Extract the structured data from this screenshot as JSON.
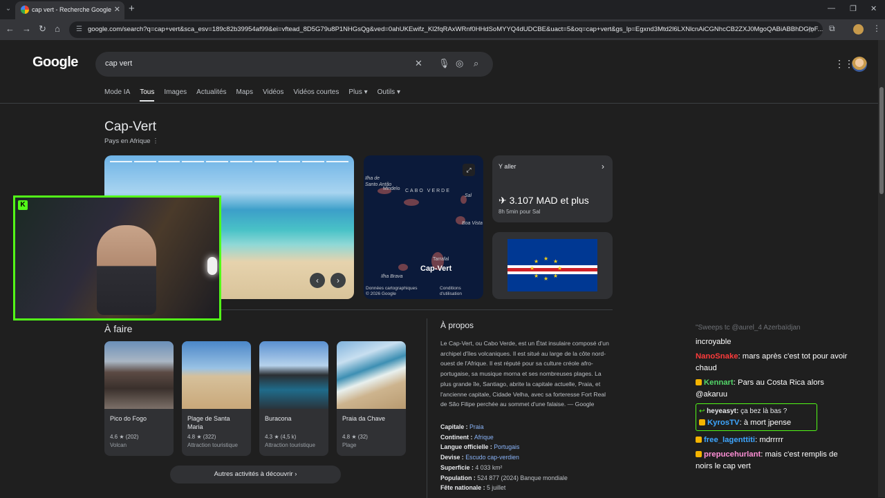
{
  "browser": {
    "tab_title": "cap vert - Recherche Google",
    "new_tab": "+",
    "url": "google.com/search?q=cap+vert&sca_esv=189c82b39954af99&ei=vftead_8D5G79u8P1NHGsQg&ved=0ahUKEwifz_Kl2fqRAxWRnf0HHdSoMYYQ4dUDCBE&uact=5&oq=cap+vert&gs_lp=Egxnd3Mtd2l6LXNlcnAiCGNhcCB2ZXJ0MgoQABiABBhDGIoF..."
  },
  "google": {
    "logo": "Google",
    "query": "cap vert",
    "tabs": [
      "Mode IA",
      "Tous",
      "Images",
      "Actualités",
      "Maps",
      "Vidéos",
      "Vidéos courtes",
      "Plus ▾",
      "Outils ▾"
    ],
    "active_tab": "Tous"
  },
  "knowledge_panel": {
    "title": "Cap-Vert",
    "subtitle": "Pays en Afrique",
    "map": {
      "labels": [
        "Ilha de Santo Antão",
        "Mindelo",
        "CABO VERDE",
        "Sal",
        "Boa Vista",
        "Tarrafal",
        "Cap-Vert",
        "Ilha Brava"
      ],
      "footer_left": "Données cartographiques © 2026 Google",
      "footer_right": "Conditions d'utilisation"
    },
    "travel": {
      "label": "Y aller",
      "price": "✈ 3.107 MAD et plus",
      "duration": "8h 5min pour Sal"
    }
  },
  "a_faire": {
    "title": "À faire",
    "cards": [
      {
        "name": "Pico do Fogo",
        "rating": "4.6 ★ (202)",
        "kind": "Volcan"
      },
      {
        "name": "Plage de Santa Maria",
        "rating": "4.8 ★ (322)",
        "kind": "Attraction touristique"
      },
      {
        "name": "Buracona",
        "rating": "4.3 ★ (4,5 k)",
        "kind": "Attraction touristique"
      },
      {
        "name": "Praia da Chave",
        "rating": "4.8 ★ (32)",
        "kind": "Plage"
      }
    ],
    "more": "Autres activités à découvrir  ›"
  },
  "about": {
    "title": "À propos",
    "text": "Le Cap-Vert, ou Cabo Verde, est un État insulaire composé d'un archipel d'îles volcaniques. Il est situé au large de la côte nord-ouest de l'Afrique. Il est réputé pour sa culture créole afro-portugaise, sa musique morna et ses nombreuses plages. La plus grande île, Santiago, abrite la capitale actuelle, Praia, et l'ancienne capitale, Cidade Velha, avec sa forteresse Fort Real de São Filipe perchée au sommet d'une falaise. — Google",
    "facts": [
      {
        "k": "Capitale : ",
        "v": "Praia",
        "link": true
      },
      {
        "k": "Continent : ",
        "v": "Afrique",
        "link": true
      },
      {
        "k": "Langue officielle : ",
        "v": "Portugais",
        "link": true
      },
      {
        "k": "Devise : ",
        "v": "Escudo cap-verdien",
        "link": true
      },
      {
        "k": "Superficie : ",
        "v": "4 033 km²",
        "link": false
      },
      {
        "k": "Population : ",
        "v": "524 877 (2024) Banque mondiale",
        "link": false
      },
      {
        "k": "Fête nationale : ",
        "v": "5 juillet",
        "link": false
      }
    ]
  },
  "chat": {
    "faded": "\"Sweeps tc @aurel_4 Azerbaïdjan",
    "messages": [
      {
        "user": "",
        "text": "incroyable",
        "color": "u-white"
      },
      {
        "user": "NanoSnake",
        "text": ": mars après c'est tot pour avoir chaud",
        "color": "u-red"
      },
      {
        "user": "Kennart",
        "text": ": Pars au Costa Rica alors @akaruu",
        "color": "u-green"
      },
      {
        "user": "free_lagenttiti",
        "text": ": mdrrrrr",
        "color": "u-blue"
      },
      {
        "user": "prepucehurlant",
        "text": ": mais c'est remplis de noirs le cap vert",
        "color": "u-pink"
      }
    ],
    "reply": {
      "quoted_user": "heyeasyt:",
      "quoted_text": "ça bez là bas ?",
      "user": "KyrosTV",
      "text": ": à mort jpense"
    }
  },
  "colors": {
    "kick_green": "#53fc18",
    "link": "#8ab4f8"
  }
}
